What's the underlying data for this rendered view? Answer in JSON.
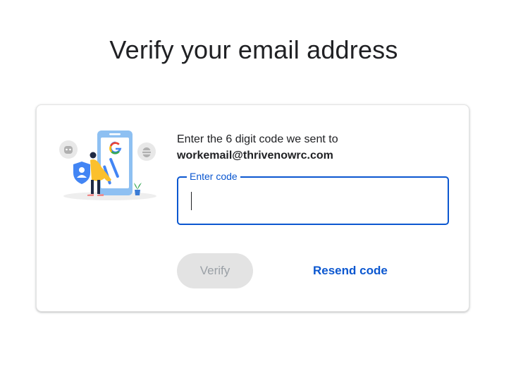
{
  "page": {
    "title": "Verify your email address"
  },
  "card": {
    "instruction": "Enter the 6 digit code we sent to",
    "email": "workemail@thrivenowrc.com"
  },
  "code_field": {
    "label": "Enter code",
    "value": ""
  },
  "actions": {
    "verify_label": "Verify",
    "resend_label": "Resend code"
  },
  "colors": {
    "accent": "#0b57d0",
    "disabled_bg": "#e3e3e3",
    "disabled_text": "#9aa0a6",
    "text": "#202124"
  },
  "icons": {
    "illustration": "phone-verification-illustration",
    "google_logo": "google-g-icon",
    "shield": "shield-user-icon",
    "bug_left": "bug-icon",
    "bug_right": "bug-icon"
  }
}
